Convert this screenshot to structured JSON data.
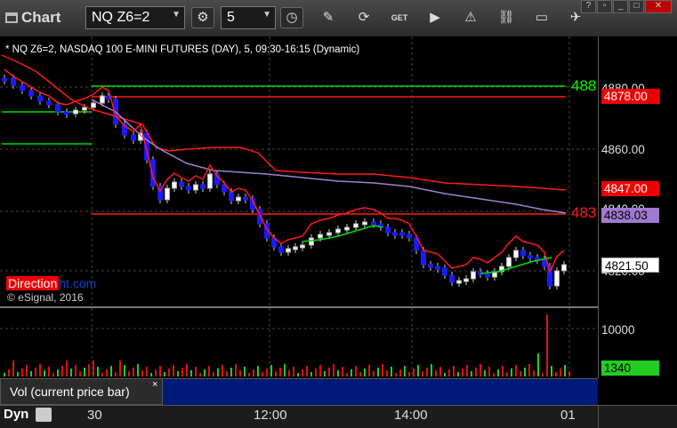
{
  "toolbar": {
    "title": "Chart",
    "symbol": "NQ Z6=2",
    "interval": "5",
    "icons": [
      "gear-icon",
      "clock-icon",
      "pencil-icon",
      "refresh-icon",
      "get-icon",
      "play-icon",
      "alert-icon",
      "link-icon",
      "comment-icon",
      "bird-icon"
    ]
  },
  "chart": {
    "title": "* NQ Z6=2, NASDAQ 100 E-MINI FUTURES (DAY), 5, 09:30-16:15 (Dynamic)",
    "logo_a": "Direction",
    "logo_b": "ht.com",
    "copyright": "© eSignal, 2016",
    "price_labels": [
      "4880.00",
      "4860.00",
      "4840.00",
      "4820.00"
    ],
    "tags": {
      "t4878": "4878.00",
      "t4847": "4847.00",
      "t4838": "4838.03",
      "t4821": "4821.50"
    },
    "line_labels": {
      "green": "488",
      "red": "483"
    },
    "colors": {
      "red": "#ff1a1a",
      "green": "#00dd00",
      "purple": "#a080d0",
      "blue": "#1a1aff"
    }
  },
  "volume": {
    "label": "Vol (current price bar)",
    "close": "×",
    "scale_label": "10000",
    "value_tag": "1340"
  },
  "time_axis": {
    "dyn": "Dyn",
    "labels": [
      "30",
      "12:00",
      "14:00",
      "01"
    ]
  }
}
